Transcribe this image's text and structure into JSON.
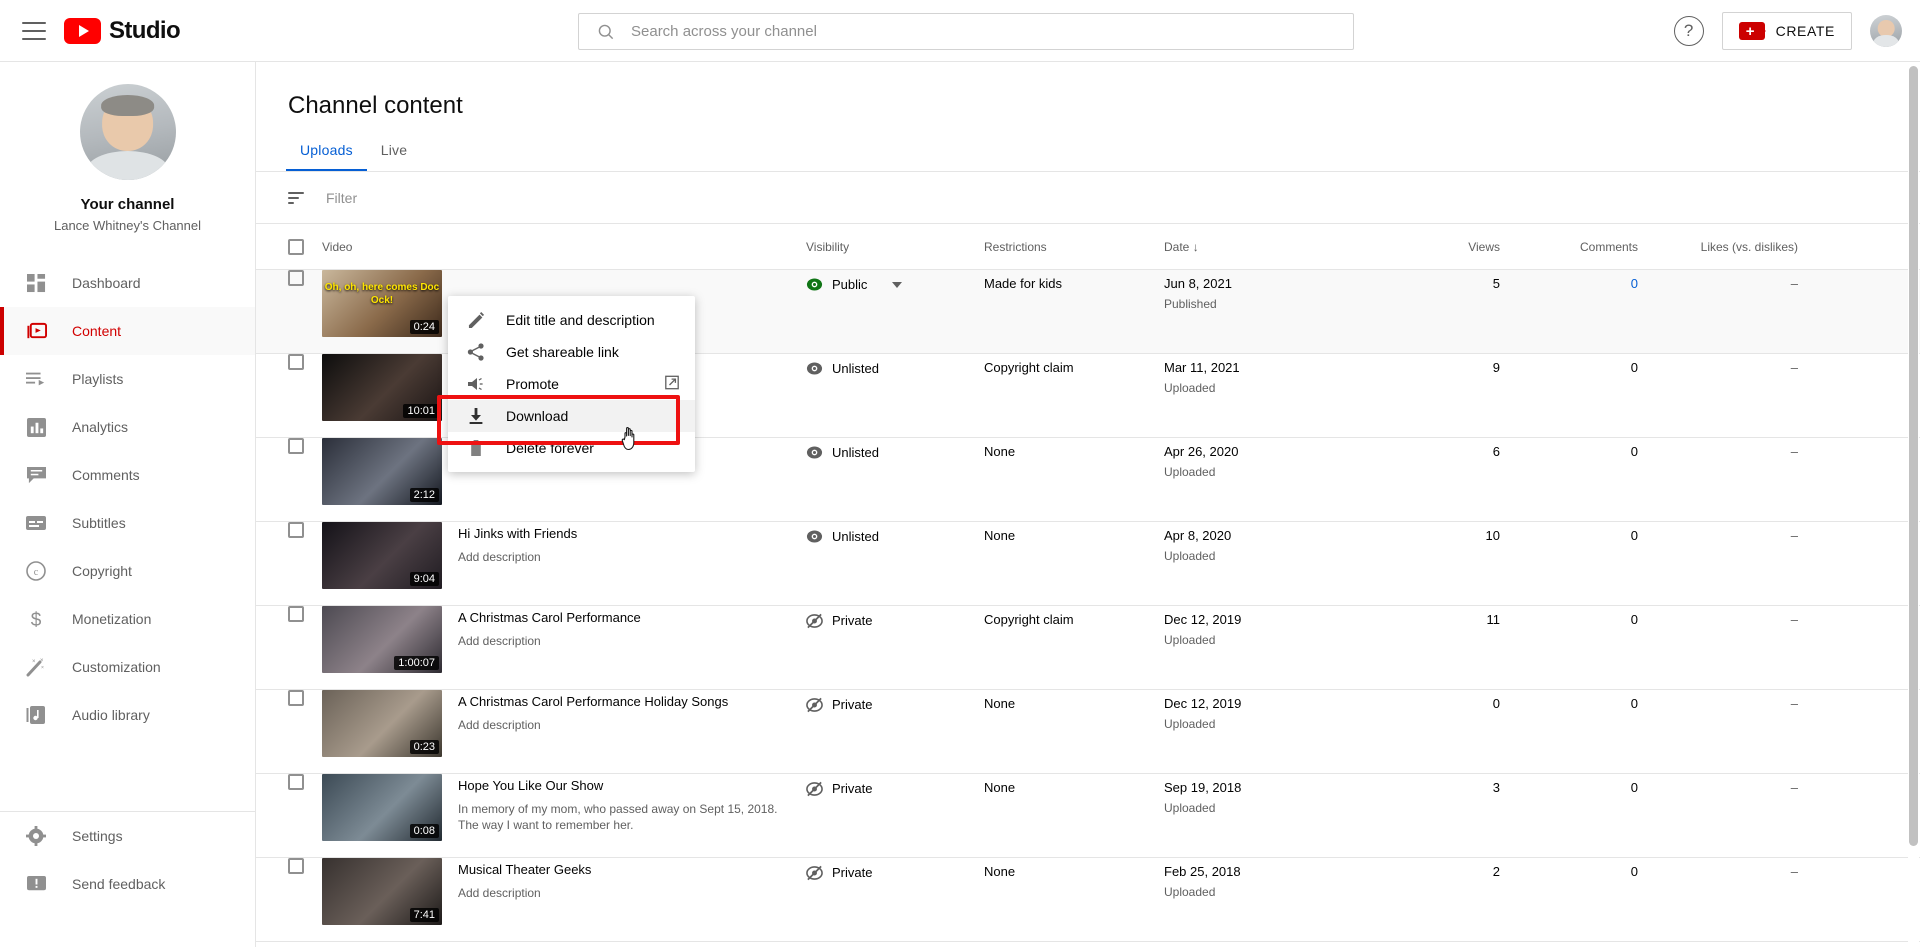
{
  "topbar": {
    "menu_icon": "hamburger-icon",
    "brand": "Studio",
    "search_placeholder": "Search across your channel",
    "help_label": "?",
    "create_label": "CREATE"
  },
  "sidebar": {
    "channel_title": "Your channel",
    "channel_name": "Lance Whitney's Channel",
    "items": [
      {
        "label": "Dashboard",
        "icon": "dashboard-icon",
        "active": false
      },
      {
        "label": "Content",
        "icon": "content-icon",
        "active": true
      },
      {
        "label": "Playlists",
        "icon": "playlists-icon",
        "active": false
      },
      {
        "label": "Analytics",
        "icon": "analytics-icon",
        "active": false
      },
      {
        "label": "Comments",
        "icon": "comments-icon",
        "active": false
      },
      {
        "label": "Subtitles",
        "icon": "subtitles-icon",
        "active": false
      },
      {
        "label": "Copyright",
        "icon": "copyright-icon",
        "active": false
      },
      {
        "label": "Monetization",
        "icon": "dollar-icon",
        "active": false
      },
      {
        "label": "Customization",
        "icon": "magic-wand-icon",
        "active": false
      },
      {
        "label": "Audio library",
        "icon": "audio-library-icon",
        "active": false
      }
    ],
    "footer_items": [
      {
        "label": "Settings",
        "icon": "gear-icon"
      },
      {
        "label": "Send feedback",
        "icon": "feedback-icon"
      }
    ]
  },
  "main": {
    "page_title": "Channel content",
    "tabs": [
      {
        "label": "Uploads",
        "active": true
      },
      {
        "label": "Live",
        "active": false
      }
    ],
    "filter_placeholder": "Filter",
    "columns": {
      "video": "Video",
      "visibility": "Visibility",
      "restrictions": "Restrictions",
      "date": "Date",
      "date_sort": "↓",
      "views": "Views",
      "comments": "Comments",
      "likes": "Likes (vs. dislikes)"
    },
    "rows": [
      {
        "title": "",
        "description": "",
        "thumb_overlay": "Oh, oh, here comes Doc Ock!",
        "duration": "0:24",
        "visibility": "Public",
        "visibility_icon": "eye-public-icon",
        "has_caret": true,
        "restrictions": "Made for kids",
        "date": "Jun 8, 2021",
        "date_status": "Published",
        "views": "5",
        "comments": "0",
        "comments_link": true,
        "likes": "–",
        "hovered": true
      },
      {
        "title": "",
        "description": "",
        "thumb_overlay": "",
        "duration": "10:01",
        "visibility": "Unlisted",
        "visibility_icon": "eye-unlisted-icon",
        "has_caret": false,
        "restrictions": "Copyright claim",
        "date": "Mar 11, 2021",
        "date_status": "Uploaded",
        "views": "9",
        "comments": "0",
        "comments_link": false,
        "likes": "–",
        "hovered": false
      },
      {
        "title": "",
        "description": "Add description",
        "thumb_overlay": "",
        "duration": "2:12",
        "visibility": "Unlisted",
        "visibility_icon": "eye-unlisted-icon",
        "has_caret": false,
        "restrictions": "None",
        "date": "Apr 26, 2020",
        "date_status": "Uploaded",
        "views": "6",
        "comments": "0",
        "comments_link": false,
        "likes": "–",
        "hovered": false
      },
      {
        "title": "Hi Jinks with Friends",
        "description": "Add description",
        "thumb_overlay": "",
        "duration": "9:04",
        "visibility": "Unlisted",
        "visibility_icon": "eye-unlisted-icon",
        "has_caret": false,
        "restrictions": "None",
        "date": "Apr 8, 2020",
        "date_status": "Uploaded",
        "views": "10",
        "comments": "0",
        "comments_link": false,
        "likes": "–",
        "hovered": false
      },
      {
        "title": "A Christmas Carol Performance",
        "description": "Add description",
        "thumb_overlay": "",
        "duration": "1:00:07",
        "visibility": "Private",
        "visibility_icon": "eye-private-icon",
        "has_caret": false,
        "restrictions": "Copyright claim",
        "date": "Dec 12, 2019",
        "date_status": "Uploaded",
        "views": "11",
        "comments": "0",
        "comments_link": false,
        "likes": "–",
        "hovered": false
      },
      {
        "title": "A Christmas Carol Performance Holiday Songs",
        "description": "Add description",
        "thumb_overlay": "",
        "duration": "0:23",
        "visibility": "Private",
        "visibility_icon": "eye-private-icon",
        "has_caret": false,
        "restrictions": "None",
        "date": "Dec 12, 2019",
        "date_status": "Uploaded",
        "views": "0",
        "comments": "0",
        "comments_link": false,
        "likes": "–",
        "hovered": false
      },
      {
        "title": "Hope You Like Our Show",
        "description": "In memory of my mom, who passed away on Sept 15, 2018. The way I want to remember her.",
        "thumb_overlay": "",
        "duration": "0:08",
        "visibility": "Private",
        "visibility_icon": "eye-private-icon",
        "has_caret": false,
        "restrictions": "None",
        "date": "Sep 19, 2018",
        "date_status": "Uploaded",
        "views": "3",
        "comments": "0",
        "comments_link": false,
        "likes": "–",
        "hovered": false
      },
      {
        "title": "Musical Theater Geeks",
        "description": "Add description",
        "thumb_overlay": "",
        "duration": "7:41",
        "visibility": "Private",
        "visibility_icon": "eye-private-icon",
        "has_caret": false,
        "restrictions": "None",
        "date": "Feb 25, 2018",
        "date_status": "Uploaded",
        "views": "2",
        "comments": "0",
        "comments_link": false,
        "likes": "–",
        "hovered": false
      }
    ]
  },
  "context_menu": {
    "items": [
      {
        "label": "Edit title and description",
        "icon": "pencil-icon",
        "highlighted": false,
        "external": false
      },
      {
        "label": "Get shareable link",
        "icon": "share-icon",
        "highlighted": false,
        "external": false
      },
      {
        "label": "Promote",
        "icon": "promote-megaphone-icon",
        "highlighted": false,
        "external": true
      },
      {
        "label": "Download",
        "icon": "download-icon",
        "highlighted": true,
        "external": false
      },
      {
        "label": "Delete forever",
        "icon": "trash-icon",
        "highlighted": false,
        "external": false
      }
    ]
  },
  "highlight": {
    "color": "#EE1111",
    "target": "Download"
  },
  "colors": {
    "accent_red": "#CC0000",
    "link_blue": "#065fd4",
    "public_green": "#107516",
    "text_primary": "#030303",
    "text_secondary": "#606060"
  }
}
